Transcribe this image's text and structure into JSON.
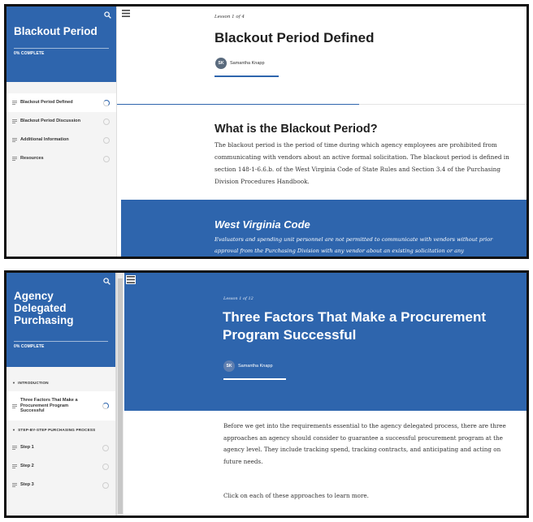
{
  "colors": {
    "brand_blue": "#2e65ad",
    "sidebar_bg": "#f4f4f4"
  },
  "screen1": {
    "sidebar": {
      "title": "Blackout Period",
      "progress": "0% COMPLETE",
      "items": [
        {
          "label": "Blackout Period Defined",
          "state": "in-progress"
        },
        {
          "label": "Blackout Period Discussion",
          "state": "not-started"
        },
        {
          "label": "Additional Information",
          "state": "not-started"
        },
        {
          "label": "Resources",
          "state": "not-started"
        }
      ]
    },
    "lesson_label": "Lesson 1 of 4",
    "title": "Blackout Period Defined",
    "author": {
      "initials": "SK",
      "name": "Samantha Knapp"
    },
    "section_heading": "What is the Blackout Period?",
    "section_text": "The blackout period is the period of time during which agency employees are prohibited from communicating with vendors about an active formal solicitation. The blackout period is defined in section 148-1-6.6.b. of the West Virginia Code of State Rules and Section 3.4 of the Purchasing Division Procedures Handbook.",
    "band_heading": "West Virginia Code",
    "band_text": "Evaluators and spending unit personnel are not permitted to communicate with vendors without prior approval from the Purchasing Division with any vendor about an existing solicitation or any"
  },
  "screen2": {
    "sidebar": {
      "title": "Agency Delegated Purchasing",
      "progress": "0% COMPLETE",
      "sections": [
        {
          "label": "INTRODUCTION",
          "items": [
            {
              "label": "Three Factors That Make a Procurement Program Successful",
              "state": "in-progress"
            }
          ]
        },
        {
          "label": "STEP-BY-STEP PURCHASING PROCESS",
          "items": [
            {
              "label": "Step 1",
              "state": "not-started"
            },
            {
              "label": "Step 2",
              "state": "not-started"
            },
            {
              "label": "Step 3",
              "state": "not-started"
            }
          ]
        }
      ]
    },
    "lesson_label": "Lesson 1 of 12",
    "title": "Three Factors That Make a Procurement Program Successful",
    "author": {
      "initials": "SK",
      "name": "Samantha Knapp"
    },
    "intro_text": "Before we get into the requirements essential to the agency delegated process, there are three approaches an agency should consider to guarantee a successful procurement program at the agency level. They include tracking spend, tracking contracts, and anticipating and acting on future needs.",
    "cta_text": "Click on each of these approaches to learn more."
  }
}
